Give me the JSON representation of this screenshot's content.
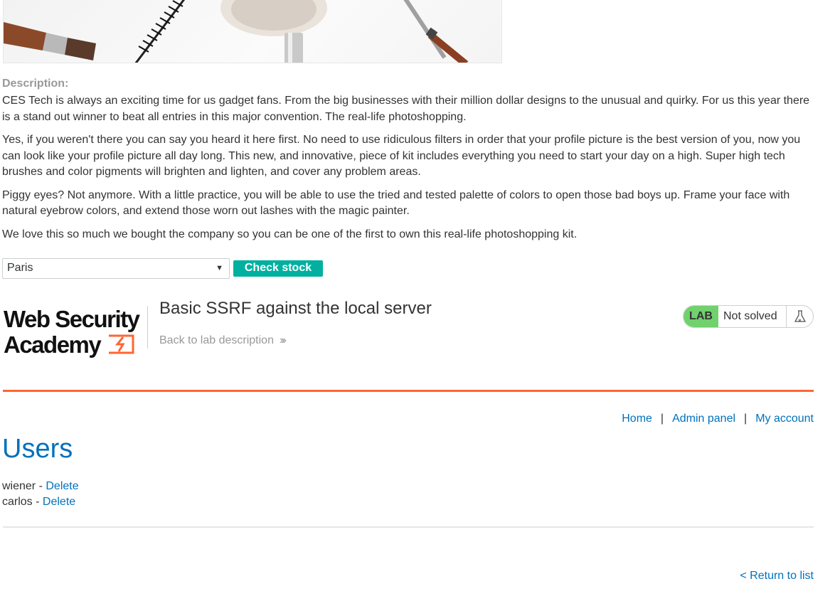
{
  "product": {
    "image_alt": "makeup brushes"
  },
  "description": {
    "label": "Description:",
    "paragraphs": [
      "CES Tech is always an exciting time for us gadget fans. From the big businesses with their million dollar designs to the unusual and quirky. For us this year there is a stand out winner to beat all entries in this major convention. The real-life photoshopping.",
      "Yes, if you weren't there you can say you heard it here first. No need to use ridiculous filters in order that your profile picture is the best version of you, now you can look like your profile picture all day long. This new, and innovative, piece of kit includes everything you need to start your day on a high. Super high tech brushes and color pigments will brighten and lighten, and cover any problem areas.",
      "Piggy eyes? Not anymore. With a little practice, you will be able to use the tried and tested palette of colors to open those bad boys up. Frame your face with natural eyebrow colors, and extend those worn out lashes with the magic painter.",
      "We love this so much we bought the company so you can be one of the first to own this real-life photoshopping kit."
    ]
  },
  "stock": {
    "selected": "Paris",
    "button_label": "Check stock"
  },
  "academy": {
    "logo_line1": "Web Security",
    "logo_line2": "Academy",
    "lab_title": "Basic SSRF against the local server",
    "back_link": "Back to lab description",
    "lab_badge": "LAB",
    "lab_status": "Not solved",
    "accent_color": "#ff6633"
  },
  "nav": {
    "home": "Home",
    "admin": "Admin panel",
    "account": "My account",
    "separator": "|"
  },
  "page": {
    "title": "Users",
    "users": [
      {
        "name": "wiener",
        "sep": " - ",
        "action": "Delete"
      },
      {
        "name": "carlos",
        "sep": " - ",
        "action": "Delete"
      }
    ],
    "return_link": "< Return to list"
  },
  "colors": {
    "link": "#0071bc",
    "button": "#01b09f",
    "lab_green": "#70d16d"
  }
}
